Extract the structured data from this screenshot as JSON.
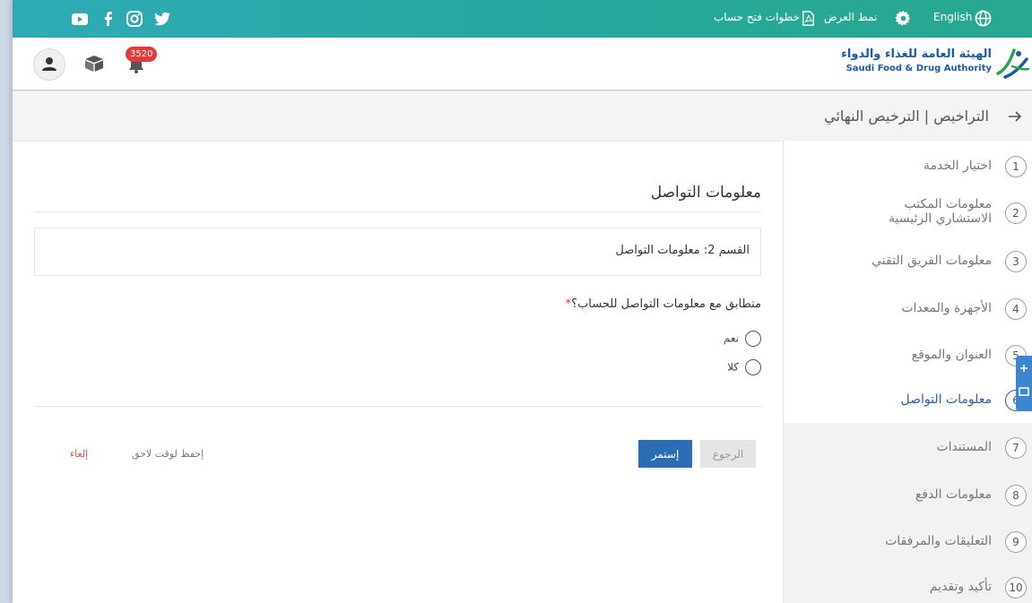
{
  "topbar": {
    "language": "English",
    "display_mode": "نمط العرض",
    "account_steps": "خطوات فتح حساب",
    "social": [
      "youtube-icon",
      "facebook-icon",
      "instagram-icon",
      "twitter-icon"
    ]
  },
  "header": {
    "logo_ar": "الهيئة العامة للغذاء والدواء",
    "logo_en": "Saudi Food & Drug Authority",
    "notifications_count": "3520"
  },
  "breadcrumb": {
    "text": "التراخيص | الترخيص النهائي"
  },
  "sidebar": {
    "steps": [
      {
        "num": "1",
        "label": "اختيار الخدمة"
      },
      {
        "num": "2",
        "label": "معلومات المكتب الاستشاري الرئيسية"
      },
      {
        "num": "3",
        "label": "معلومات الفريق التقني"
      },
      {
        "num": "4",
        "label": "الأجهزة والمعدات"
      },
      {
        "num": "5",
        "label": "العنوان والموقع"
      },
      {
        "num": "6",
        "label": "معلومات التواصل"
      },
      {
        "num": "7",
        "label": "المستندات"
      },
      {
        "num": "8",
        "label": "معلومات الدفع"
      },
      {
        "num": "9",
        "label": "التعليقات والمرفقات"
      },
      {
        "num": "10",
        "label": "تأكيد وتقديم"
      }
    ],
    "active_step": 6
  },
  "main": {
    "title": "معلومات التواصل",
    "section_label": "القسم 2: معلومات التواصل",
    "question": "متطابق مع معلومات التواصل للحساب؟",
    "required_mark": "*",
    "options": [
      {
        "label": "نعم"
      },
      {
        "label": "كلا"
      }
    ],
    "buttons": {
      "continue": "إستمر",
      "back": "الرجوع",
      "save_later": "إحفظ لوقت لاحق",
      "cancel": "إلغاء"
    }
  },
  "colors": {
    "topbar": "#28a89c",
    "primary": "#2b6cb4",
    "active": "#2b5ea7",
    "danger": "#d9534f"
  }
}
